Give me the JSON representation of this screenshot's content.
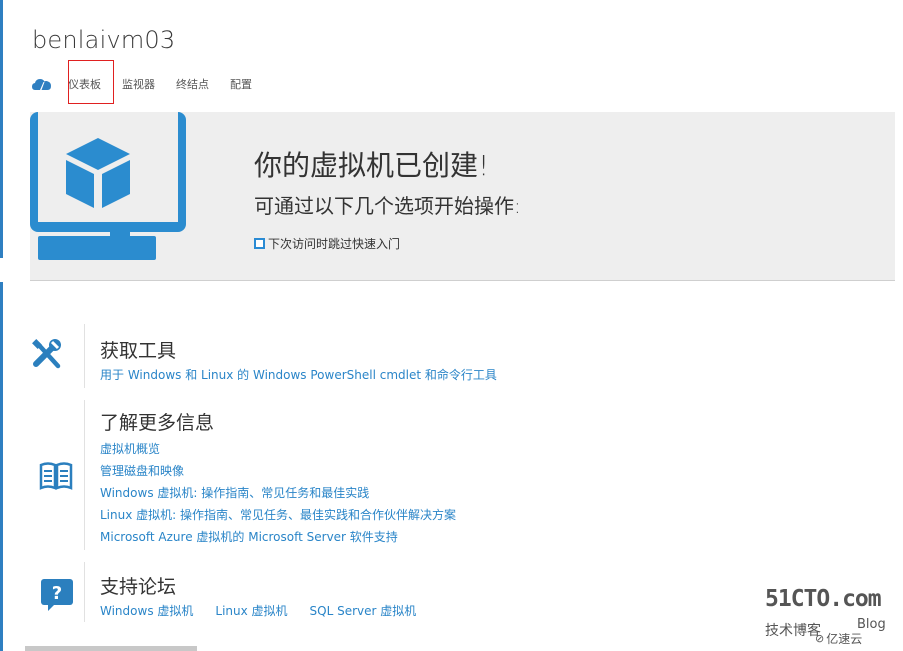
{
  "vm": {
    "title": "benlaivm03"
  },
  "tabs": [
    "仪表板",
    "监视器",
    "终结点",
    "配置"
  ],
  "colors": {
    "accent": "#2f7fc1",
    "link": "#2a85c8",
    "highlight": "#e02020",
    "hero_bg": "#eeeeee"
  },
  "hero": {
    "heading": "你的虚拟机已创建!",
    "subheading": "可通过以下几个选项开始操作:",
    "skip_label": "下次访问时跳过快速入门",
    "skip_checked": false
  },
  "sections": {
    "tools": {
      "title": "获取工具",
      "links": [
        "用于 Windows 和 Linux 的 Windows PowerShell cmdlet 和命令行工具"
      ]
    },
    "learn": {
      "title": "了解更多信息",
      "links": [
        "虚拟机概览",
        "管理磁盘和映像",
        "Windows 虚拟机: 操作指南、常见任务和最佳实践",
        "Linux 虚拟机: 操作指南、常见任务、最佳实践和合作伙伴解决方案",
        "Microsoft Azure 虚拟机的 Microsoft Server 软件支持"
      ]
    },
    "forums": {
      "title": "支持论坛",
      "links": [
        "Windows 虚拟机",
        "Linux 虚拟机",
        "SQL Server 虚拟机"
      ]
    }
  },
  "watermark": {
    "logo": "51CTO.com",
    "sub": "技术博客",
    "blog": "Blog",
    "brand": "亿速云"
  },
  "icons": {
    "tab_cloud": "cloud-icon",
    "monitor": "monitor-cube-icon",
    "tools": "tools-icon",
    "book": "book-icon",
    "question": "question-bubble-icon"
  }
}
